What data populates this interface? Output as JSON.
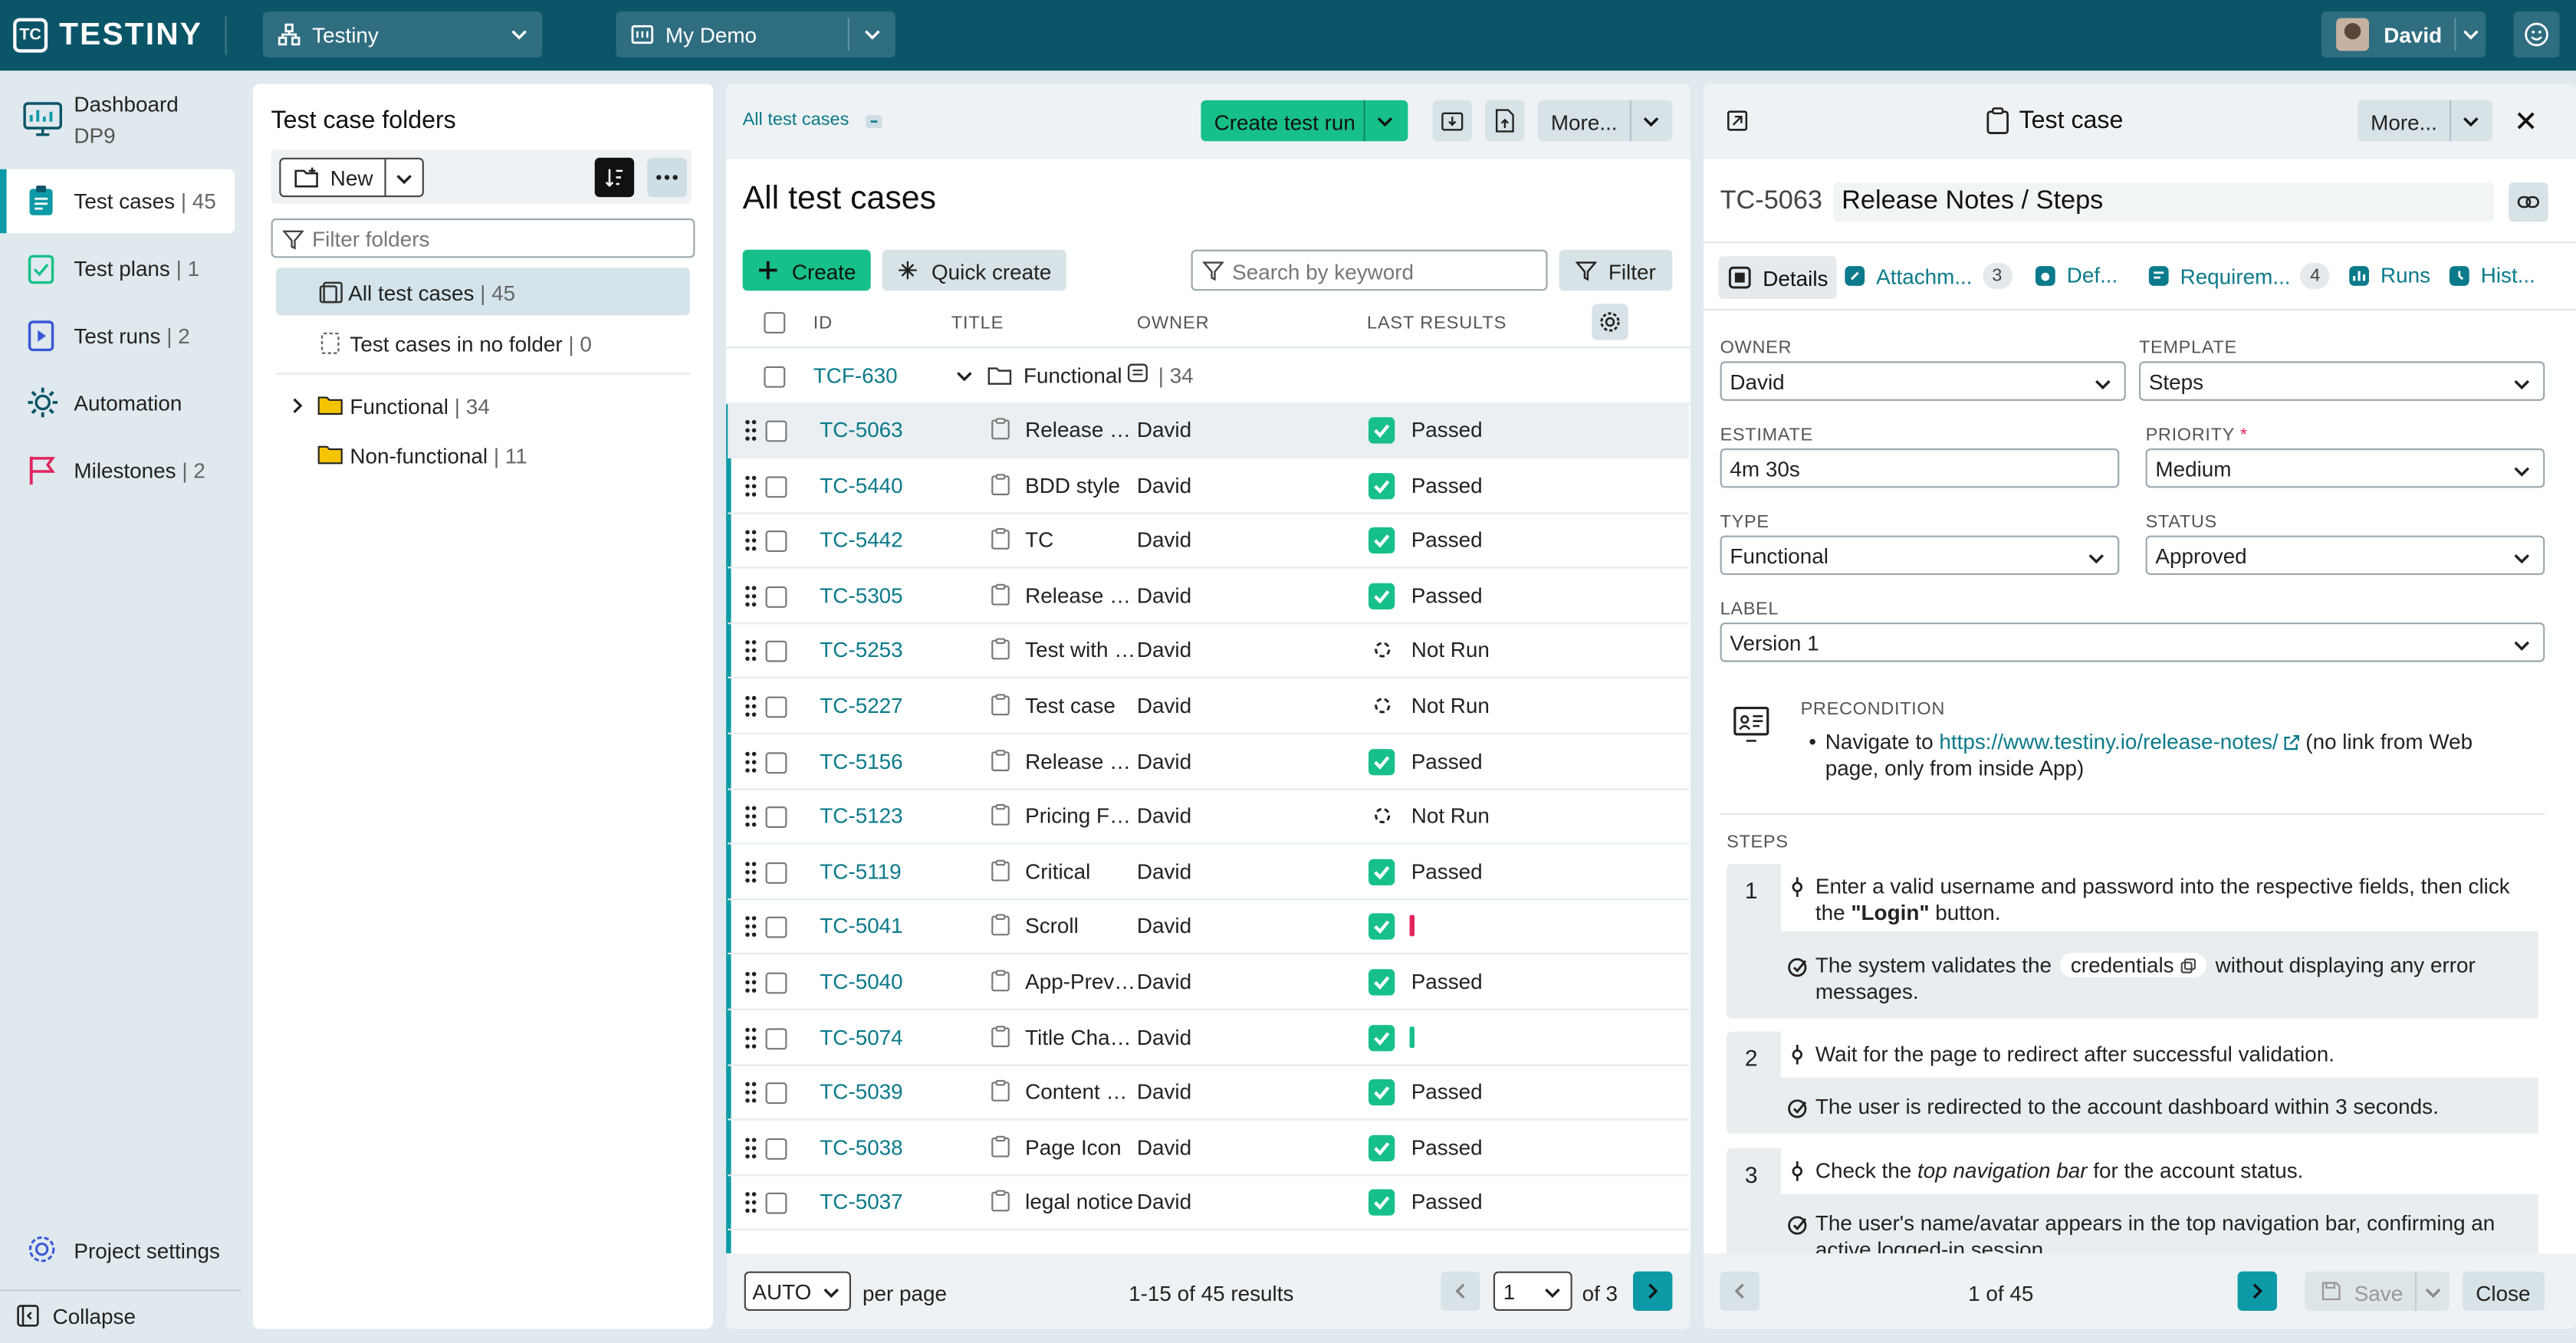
{
  "app": {
    "brand": "TESTINY",
    "brand_glyph": "TC",
    "workspace": "Testiny",
    "project": "My Demo",
    "user": "David",
    "colors": {
      "topbar": "#0b5569",
      "accent": "#0d9aa6",
      "teal_button": "#17c08a",
      "passed": "#17c08a",
      "failed": "#e0245e"
    }
  },
  "nav": {
    "dashboard": {
      "label": "Dashboard",
      "sub": "DP9",
      "icon": "dashboard-icon"
    },
    "items": [
      {
        "label": "Test cases",
        "count": "| 45",
        "icon": "clipboard-icon",
        "active": true
      },
      {
        "label": "Test plans",
        "count": "| 1",
        "icon": "test-plan-icon"
      },
      {
        "label": "Test runs",
        "count": "| 2",
        "icon": "play-icon"
      },
      {
        "label": "Automation",
        "count": "",
        "icon": "automation-gear-icon"
      },
      {
        "label": "Milestones",
        "count": "| 2",
        "icon": "flag-icon"
      }
    ],
    "project_settings": "Project settings",
    "collapse": "Collapse"
  },
  "folders": {
    "title": "Test case folders",
    "new_label": "New",
    "filter_placeholder": "Filter folders",
    "all": {
      "label": "All test cases",
      "count": "| 45"
    },
    "nofolder": {
      "label": "Test cases in no folder",
      "count": "| 0"
    },
    "functional": {
      "label": "Functional",
      "count": "| 34"
    },
    "nonfunctional": {
      "label": "Non-functional",
      "count": "| 11"
    }
  },
  "cases": {
    "breadcrumb": "All test cases",
    "heading": "All test cases",
    "create_run": "Create test run",
    "more": "More...",
    "create": "Create",
    "quick_create": "Quick create",
    "search_placeholder": "Search by keyword",
    "filter": "Filter",
    "columns": {
      "id": "ID",
      "title": "TITLE",
      "owner": "OWNER",
      "last": "LAST RESULTS"
    },
    "group": {
      "id": "TCF-630",
      "name": "Functional",
      "count": "| 34"
    },
    "rows": [
      {
        "id": "TC-5063",
        "title": "Release Notes / Steps",
        "owner": "David",
        "result": "Passed",
        "status": "passed",
        "selected": true
      },
      {
        "id": "TC-5440",
        "title": "BDD style",
        "owner": "David",
        "result": "Passed",
        "status": "passed"
      },
      {
        "id": "TC-5442",
        "title": "TC",
        "owner": "David",
        "result": "Passed",
        "status": "passed"
      },
      {
        "id": "TC-5305",
        "title": "Release notes",
        "owner": "David",
        "result": "Passed",
        "status": "passed"
      },
      {
        "id": "TC-5253",
        "title": "Test with steps",
        "owner": "David",
        "result": "Not Run",
        "status": "notrun"
      },
      {
        "id": "TC-5227",
        "title": "Test case",
        "owner": "David",
        "result": "Not Run",
        "status": "notrun"
      },
      {
        "id": "TC-5156",
        "title": "Release notes",
        "owner": "David",
        "result": "Passed",
        "status": "passed"
      },
      {
        "id": "TC-5123",
        "title": "Pricing Features",
        "owner": "David",
        "result": "Not Run",
        "status": "notrun"
      },
      {
        "id": "TC-5119",
        "title": "Critical",
        "owner": "David",
        "result": "Passed",
        "status": "passed"
      },
      {
        "id": "TC-5041",
        "title": "Scroll",
        "owner": "David",
        "result": "",
        "status": "mixed-red"
      },
      {
        "id": "TC-5040",
        "title": "App-Preview",
        "owner": "David",
        "result": "Passed",
        "status": "passed"
      },
      {
        "id": "TC-5074",
        "title": "Title Change",
        "owner": "David",
        "result": "",
        "status": "mixed-green"
      },
      {
        "id": "TC-5039",
        "title": "Content check",
        "owner": "David",
        "result": "Passed",
        "status": "passed"
      },
      {
        "id": "TC-5038",
        "title": "Page Icon",
        "owner": "David",
        "result": "Passed",
        "status": "passed"
      },
      {
        "id": "TC-5037",
        "title": "legal notice",
        "owner": "David",
        "result": "Passed",
        "status": "passed"
      }
    ],
    "per_page_value": "AUTO",
    "per_page_label": "per page",
    "results": "1-15 of 45 results",
    "page": "1",
    "of_pages": "of 3"
  },
  "detail": {
    "title": "Test case",
    "more": "More...",
    "id": "TC-5063",
    "name": "Release Notes / Steps",
    "tabs": [
      {
        "label": "Details",
        "badge": ""
      },
      {
        "label": "Attachm...",
        "badge": "3"
      },
      {
        "label": "Def...",
        "badge": ""
      },
      {
        "label": "Requirem...",
        "badge": "4"
      },
      {
        "label": "Runs",
        "badge": ""
      },
      {
        "label": "Hist...",
        "badge": ""
      }
    ],
    "owner_label": "OWNER",
    "owner": "David",
    "template_label": "TEMPLATE",
    "template": "Steps",
    "estimate_label": "ESTIMATE",
    "estimate": "4m 30s",
    "priority_label": "PRIORITY",
    "priority": "Medium",
    "type_label": "TYPE",
    "type": "Functional",
    "status_label": "STATUS",
    "status": "Approved",
    "label_label": "LABEL",
    "label": "Version 1",
    "precondition_label": "PRECONDITION",
    "pre_text1": "Navigate to ",
    "pre_link": "https://www.testiny.io/release-notes/",
    "pre_text2": " (no link from Web page, only from inside App)",
    "steps_label": "STEPS",
    "steps": [
      {
        "num": "1",
        "a1": "Enter a valid username and password into the respective fields, then click the ",
        "a_bold": "\"Login\"",
        "a2": " button.",
        "r1": "The system validates the ",
        "r_chip": "credentials",
        "r2": " without displaying any error messages."
      },
      {
        "num": "2",
        "a1": "Wait for the page to redirect after successful validation.",
        "r1": "The user is redirected to the account dashboard within 3 seconds."
      },
      {
        "num": "3",
        "a1": "Check the ",
        "a_italic": "top navigation bar",
        "a2": " for the account status.",
        "r1": "The user's name/avatar appears in the top navigation bar, confirming an active logged-in session."
      }
    ],
    "pager": "1 of 45",
    "save": "Save",
    "close": "Close"
  }
}
